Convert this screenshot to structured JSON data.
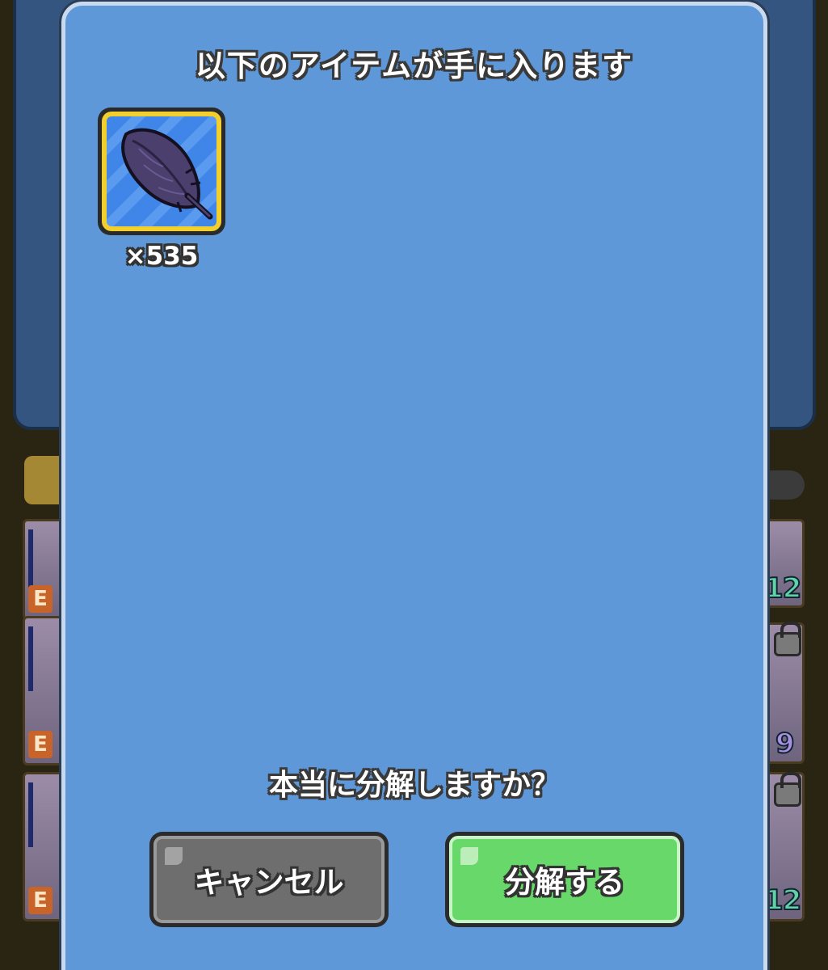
{
  "dialog": {
    "title": "以下のアイテムが手に入ります",
    "item": {
      "icon": "feather-icon",
      "quantity": "×535"
    },
    "confirm_text": "本当に分解しますか？",
    "cancel_label": "キャンセル",
    "confirm_label": "分解する"
  },
  "background": {
    "card_badges": [
      "E",
      "E",
      "E"
    ],
    "right_numbers": [
      "12",
      "9",
      "12"
    ]
  },
  "colors": {
    "dialog_bg": "#5e98d8",
    "cancel_button": "#6e6e6e",
    "confirm_button": "#68d86a",
    "item_frame": "#f3cf2e"
  }
}
